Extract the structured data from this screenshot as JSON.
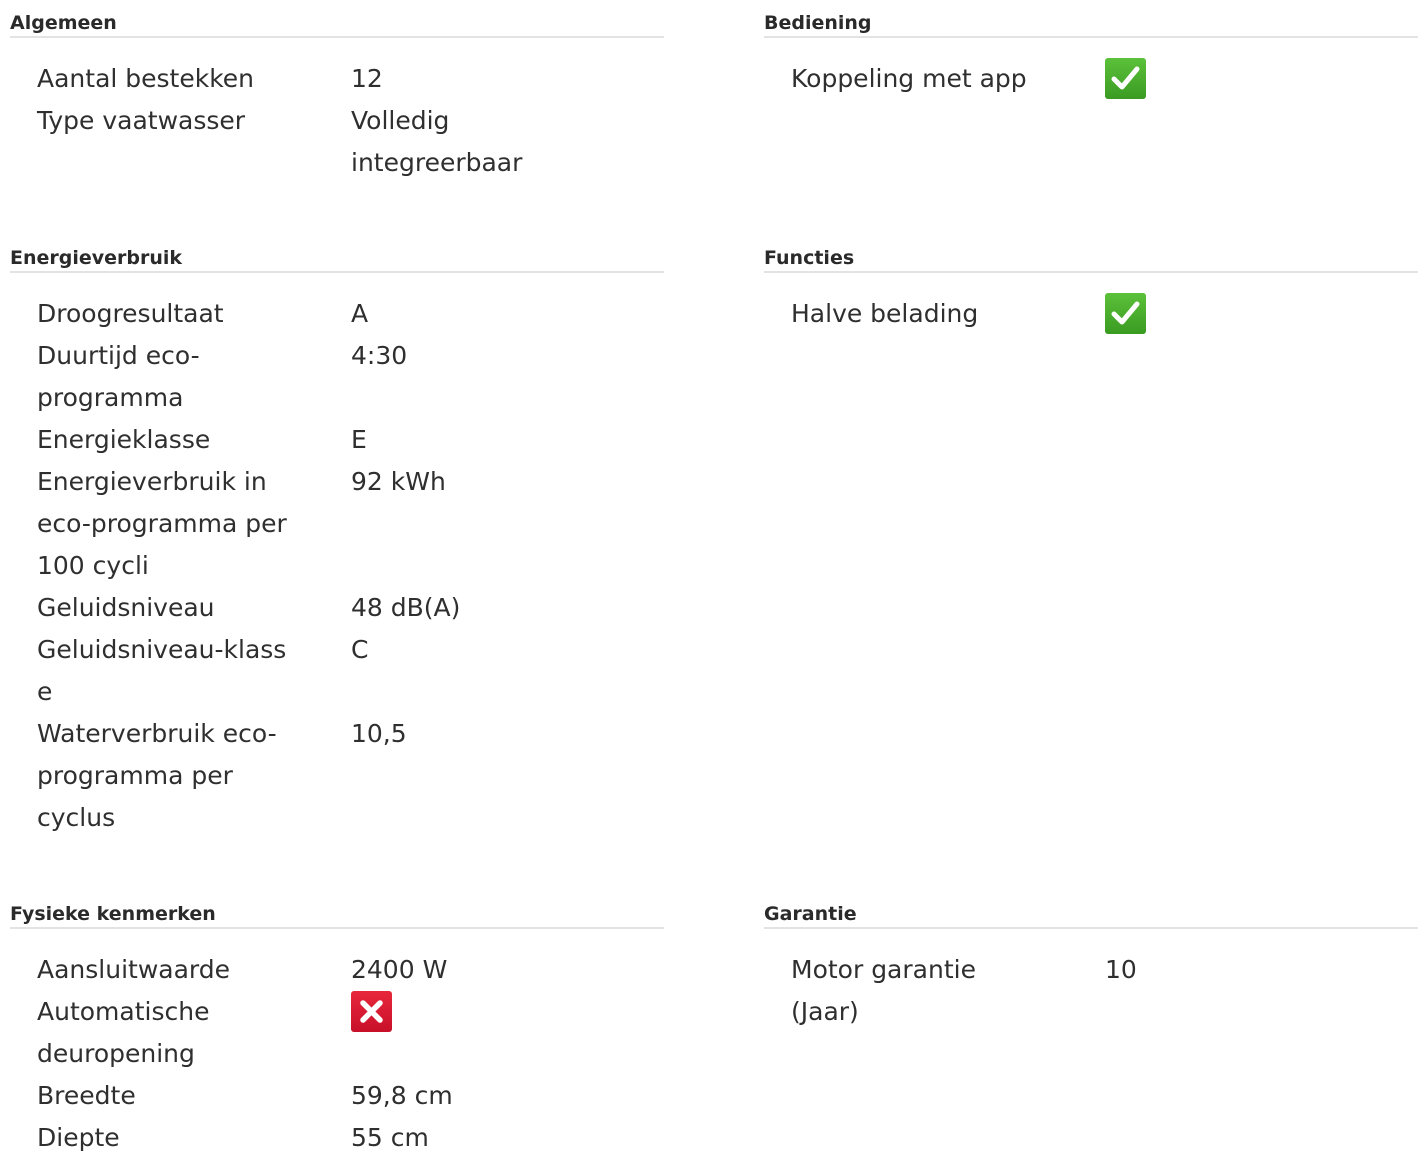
{
  "sections": {
    "algemeen": {
      "title": "Algemeen",
      "rows": [
        {
          "label": "Aantal bestekken",
          "value": "12"
        },
        {
          "label": "Type vaatwasser",
          "value": "Volledig integreerbaar"
        }
      ]
    },
    "bediening": {
      "title": "Bediening",
      "rows": [
        {
          "label": "Koppeling met app",
          "value_icon": "check-icon"
        }
      ]
    },
    "energieverbruik": {
      "title": "Energieverbruik",
      "rows": [
        {
          "label": "Droogresultaat",
          "value": "A"
        },
        {
          "label": "Duurtijd eco-programma",
          "value": "4:30"
        },
        {
          "label": "Energieklasse",
          "value": "E"
        },
        {
          "label": "Energieverbruik in eco-programma per 100 cycli",
          "value": "92 kWh"
        },
        {
          "label": "Geluidsniveau",
          "value": "48 dB(A)"
        },
        {
          "label": "Geluidsniveau-klasse",
          "value": "C"
        },
        {
          "label": "Waterverbruik eco-programma per cyclus",
          "value": "10,5"
        }
      ]
    },
    "functies": {
      "title": "Functies",
      "rows": [
        {
          "label": "Halve belading",
          "value_icon": "check-icon"
        }
      ]
    },
    "fysieke": {
      "title": "Fysieke kenmerken",
      "rows": [
        {
          "label": "Aansluitwaarde",
          "value": "2400 W"
        },
        {
          "label": "Automatische deuropening",
          "value_icon": "cross-icon"
        },
        {
          "label": "Breedte",
          "value": "59,8 cm"
        },
        {
          "label": "Diepte",
          "value": "55 cm"
        }
      ]
    },
    "garantie": {
      "title": "Garantie",
      "rows": [
        {
          "label": "Motor garantie (Jaar)",
          "value": "10"
        }
      ]
    }
  },
  "colors": {
    "check": "#45ad2b",
    "cross": "#d7162f",
    "divider": "#e3e3e3",
    "text": "#2f2f2f"
  }
}
